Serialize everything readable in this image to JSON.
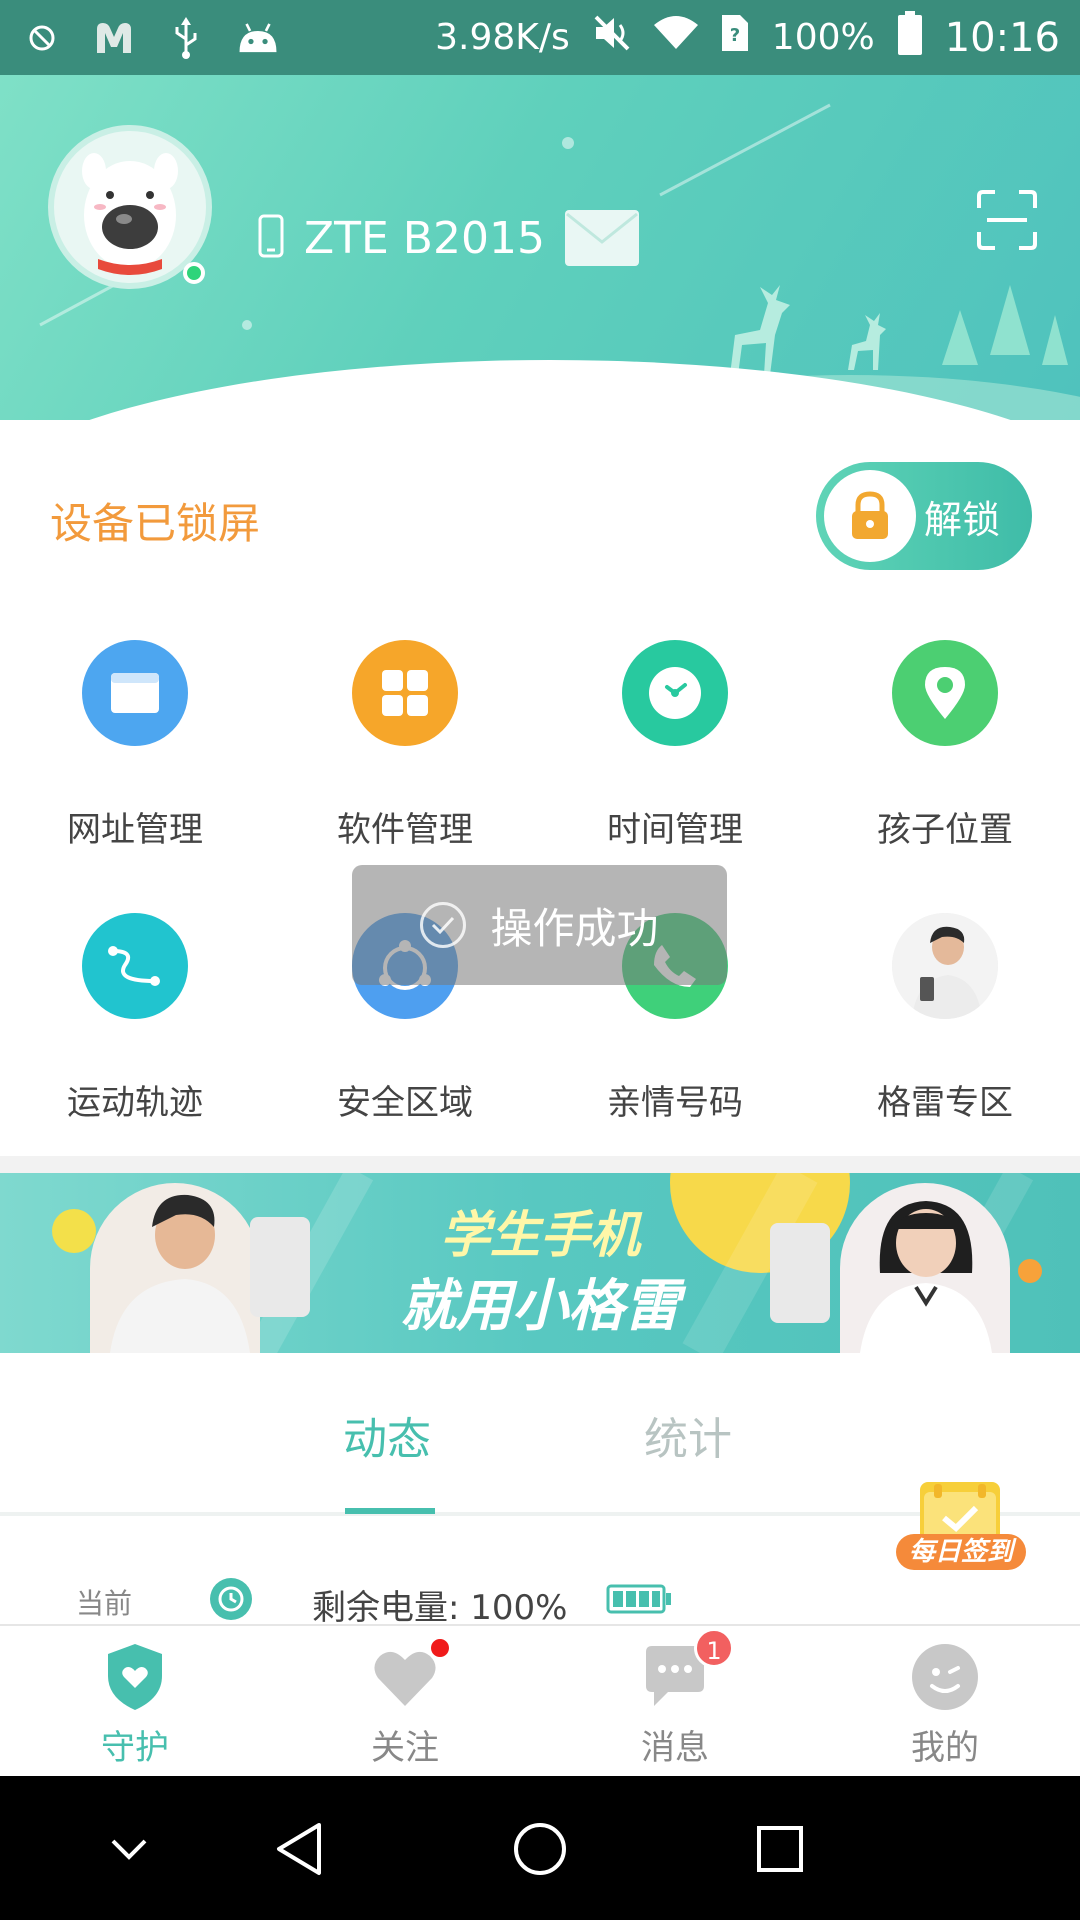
{
  "status_bar": {
    "speed": "3.98K/s",
    "battery": "100%",
    "time": "10:16",
    "icons": [
      "blocked-icon",
      "m-app-icon",
      "usb-icon",
      "android-icon",
      "mute-icon",
      "wifi-icon",
      "sim-unknown-icon",
      "battery-icon"
    ]
  },
  "header": {
    "device_name": "ZTE B2015",
    "icons": [
      "avatar",
      "phone-icon",
      "mail-icon",
      "scan-icon"
    ]
  },
  "lock": {
    "status_text": "设备已锁屏",
    "unlock_label": "解锁"
  },
  "grid": [
    {
      "label": "网址管理",
      "color": "#4da6f0",
      "icon": "browser-icon"
    },
    {
      "label": "软件管理",
      "color": "#f6a62a",
      "icon": "apps-icon"
    },
    {
      "label": "时间管理",
      "color": "#28c99f",
      "icon": "clock-icon"
    },
    {
      "label": "孩子位置",
      "color": "#4ccf72",
      "icon": "location-pin-icon"
    },
    {
      "label": "运动轨迹",
      "color": "#21c4cf",
      "icon": "route-icon"
    },
    {
      "label": "安全区域",
      "color": "#4e9ff0",
      "icon": "safe-zone-icon"
    },
    {
      "label": "亲情号码",
      "color": "#3fd07a",
      "icon": "phone-call-icon"
    },
    {
      "label": "格雷专区",
      "color": "#e8e8e8",
      "icon": "promo-photo"
    }
  ],
  "toast": {
    "text": "操作成功"
  },
  "banner": {
    "line1": "学生手机",
    "line2": "就用小格雷"
  },
  "tabs": [
    {
      "label": "动态",
      "active": true
    },
    {
      "label": "统计",
      "active": false
    }
  ],
  "checkin": {
    "label": "每日签到"
  },
  "activity": {
    "time": "当前",
    "text": "剩余电量: 100%"
  },
  "bottom_nav": [
    {
      "label": "守护",
      "active": true,
      "icon": "shield-heart-icon"
    },
    {
      "label": "关注",
      "active": false,
      "icon": "heart-icon",
      "dot": true
    },
    {
      "label": "消息",
      "active": false,
      "icon": "chat-icon",
      "badge": "1"
    },
    {
      "label": "我的",
      "active": false,
      "icon": "profile-face-icon"
    }
  ],
  "colors": {
    "accent": "#47bfae",
    "lock_status": "#f29a3c",
    "status_bar": "#3a8d7c"
  }
}
